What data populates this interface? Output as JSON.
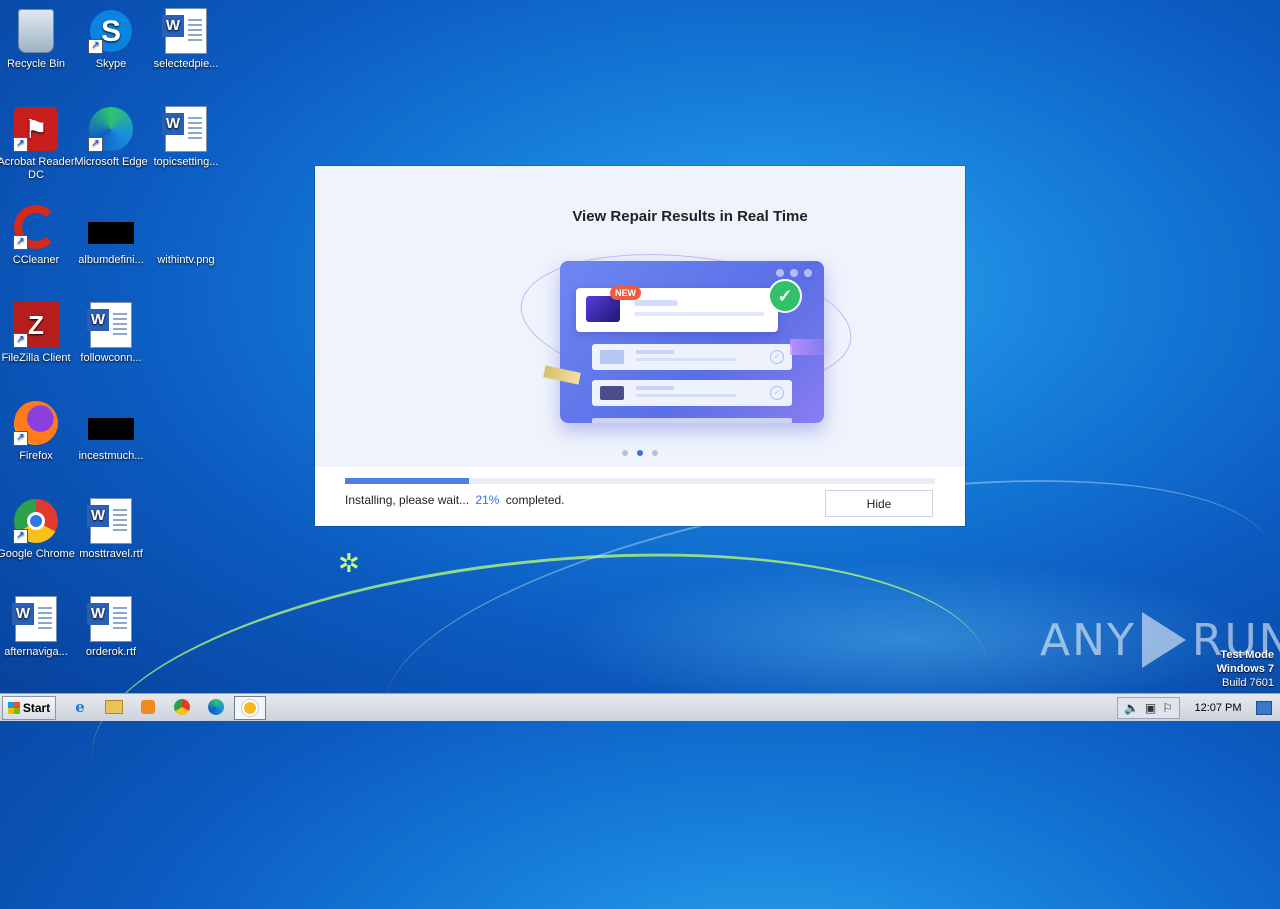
{
  "desktop": {
    "icons": [
      {
        "label": "Recycle Bin"
      },
      {
        "label": "Skype"
      },
      {
        "label": "selectedpie..."
      },
      {
        "label": "Acrobat Reader DC"
      },
      {
        "label": "Microsoft Edge"
      },
      {
        "label": "topicsetting..."
      },
      {
        "label": "CCleaner"
      },
      {
        "label": "albumdefini..."
      },
      {
        "label": "withintv.png"
      },
      {
        "label": "FileZilla Client"
      },
      {
        "label": "followconn..."
      },
      {
        "label": "Firefox"
      },
      {
        "label": "incestmuch..."
      },
      {
        "label": "Google Chrome"
      },
      {
        "label": "mosttravel.rtf"
      },
      {
        "label": "afternaviga..."
      },
      {
        "label": "orderok.rtf"
      }
    ]
  },
  "dialog": {
    "title": "View Repair Results in Real Time",
    "badge": "NEW",
    "progress_percent": 21,
    "status_prefix": "Installing, please wait...",
    "status_value": "21%",
    "status_suffix": "completed.",
    "hide_label": "Hide",
    "carousel_active_index": 1
  },
  "watermark": {
    "left_text": "ANY",
    "right_text": "RUN"
  },
  "system": {
    "mode": "Test Mode",
    "os": "Windows 7",
    "build": "Build 7601"
  },
  "taskbar": {
    "start_label": "Start",
    "clock": "12:07 PM"
  },
  "colors": {
    "accent": "#4f7fe6",
    "check": "#32c06a",
    "badge": "#f25a3a"
  }
}
